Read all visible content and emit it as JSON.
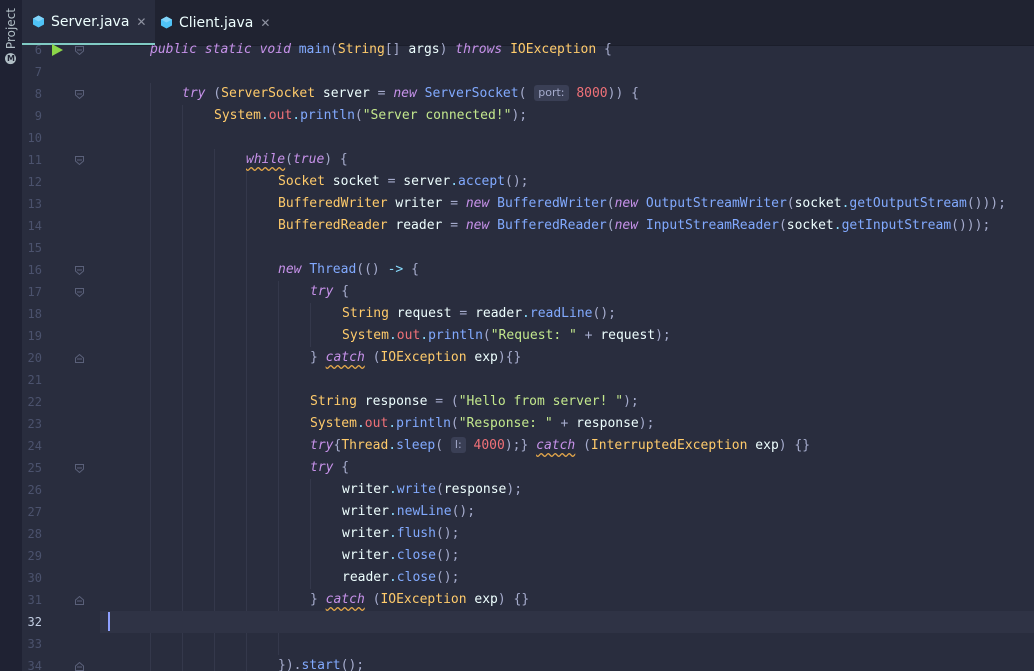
{
  "sidebar": {
    "label": "Project"
  },
  "tabs": [
    {
      "name": "Server.java",
      "active": true
    },
    {
      "name": "Client.java",
      "active": false
    }
  ],
  "colors": {
    "background": "#292d3e",
    "accent": "#80cbc4",
    "run": "#8bd649",
    "caret": "#8ea0ff"
  },
  "editor": {
    "current_line": 32,
    "lines": [
      {
        "n": "6",
        "indent": 1,
        "fold": "open",
        "run": true,
        "tokens": [
          [
            "kw",
            "public"
          ],
          [
            "pl",
            " "
          ],
          [
            "kw",
            "static"
          ],
          [
            "pl",
            " "
          ],
          [
            "kw",
            "void"
          ],
          [
            "pl",
            " "
          ],
          [
            "fn",
            "main"
          ],
          [
            "pl",
            "("
          ],
          [
            "ty",
            "String"
          ],
          [
            "pl",
            "[] "
          ],
          [
            "va",
            "args"
          ],
          [
            "pl",
            ") "
          ],
          [
            "kw",
            "throws"
          ],
          [
            "pl",
            " "
          ],
          [
            "ty",
            "IOException"
          ],
          [
            "pl",
            " {"
          ]
        ]
      },
      {
        "n": "7",
        "indent": 0,
        "tokens": []
      },
      {
        "n": "8",
        "indent": 2,
        "fold": "open",
        "tokens": [
          [
            "kw",
            "try"
          ],
          [
            "pl",
            " ("
          ],
          [
            "ty",
            "ServerSocket"
          ],
          [
            "pl",
            " "
          ],
          [
            "va",
            "server"
          ],
          [
            "pl",
            " = "
          ],
          [
            "kw",
            "new"
          ],
          [
            "pl",
            " "
          ],
          [
            "fn",
            "ServerSocket"
          ],
          [
            "pl",
            "( "
          ],
          [
            "hint",
            "port:"
          ],
          [
            "pl",
            " "
          ],
          [
            "fd",
            "8000"
          ],
          [
            "pl",
            ")) {"
          ]
        ]
      },
      {
        "n": "9",
        "indent": 3,
        "tokens": [
          [
            "ty",
            "System"
          ],
          [
            "pr",
            "."
          ],
          [
            "fd",
            "out"
          ],
          [
            "pr",
            "."
          ],
          [
            "fn",
            "println"
          ],
          [
            "pl",
            "("
          ],
          [
            "st",
            "\"Server connected!\""
          ],
          [
            "pl",
            ");"
          ]
        ]
      },
      {
        "n": "10",
        "indent": 0,
        "tokens": []
      },
      {
        "n": "11",
        "indent": 4,
        "fold": "open",
        "tokens": [
          [
            "kwwavy",
            "while"
          ],
          [
            "pl",
            "("
          ],
          [
            "kw",
            "true"
          ],
          [
            "pl",
            ") {"
          ]
        ]
      },
      {
        "n": "12",
        "indent": 5,
        "tokens": [
          [
            "ty",
            "Socket"
          ],
          [
            "pl",
            " "
          ],
          [
            "va",
            "socket"
          ],
          [
            "pl",
            " = "
          ],
          [
            "va",
            "server"
          ],
          [
            "pr",
            "."
          ],
          [
            "fn",
            "accept"
          ],
          [
            "pl",
            "();"
          ]
        ]
      },
      {
        "n": "13",
        "indent": 5,
        "tokens": [
          [
            "ty",
            "BufferedWriter"
          ],
          [
            "pl",
            " "
          ],
          [
            "va",
            "writer"
          ],
          [
            "pl",
            " = "
          ],
          [
            "kw",
            "new"
          ],
          [
            "pl",
            " "
          ],
          [
            "fn",
            "BufferedWriter"
          ],
          [
            "pl",
            "("
          ],
          [
            "kw",
            "new"
          ],
          [
            "pl",
            " "
          ],
          [
            "fn",
            "OutputStreamWriter"
          ],
          [
            "pl",
            "("
          ],
          [
            "va",
            "socket"
          ],
          [
            "pr",
            "."
          ],
          [
            "fn",
            "getOutputStream"
          ],
          [
            "pl",
            "()));"
          ]
        ]
      },
      {
        "n": "14",
        "indent": 5,
        "tokens": [
          [
            "ty",
            "BufferedReader"
          ],
          [
            "pl",
            " "
          ],
          [
            "va",
            "reader"
          ],
          [
            "pl",
            " = "
          ],
          [
            "kw",
            "new"
          ],
          [
            "pl",
            " "
          ],
          [
            "fn",
            "BufferedReader"
          ],
          [
            "pl",
            "("
          ],
          [
            "kw",
            "new"
          ],
          [
            "pl",
            " "
          ],
          [
            "fn",
            "InputStreamReader"
          ],
          [
            "pl",
            "("
          ],
          [
            "va",
            "socket"
          ],
          [
            "pr",
            "."
          ],
          [
            "fn",
            "getInputStream"
          ],
          [
            "pl",
            "()));"
          ]
        ]
      },
      {
        "n": "15",
        "indent": 0,
        "tokens": []
      },
      {
        "n": "16",
        "indent": 5,
        "fold": "open",
        "tokens": [
          [
            "kw",
            "new"
          ],
          [
            "pl",
            " "
          ],
          [
            "fn",
            "Thread"
          ],
          [
            "pl",
            "(() "
          ],
          [
            "pr",
            "->"
          ],
          [
            "pl",
            " {"
          ]
        ]
      },
      {
        "n": "17",
        "indent": 6,
        "fold": "open",
        "tokens": [
          [
            "kw",
            "try"
          ],
          [
            "pl",
            " {"
          ]
        ]
      },
      {
        "n": "18",
        "indent": 7,
        "tokens": [
          [
            "ty",
            "String"
          ],
          [
            "pl",
            " "
          ],
          [
            "va",
            "request"
          ],
          [
            "pl",
            " = "
          ],
          [
            "va",
            "reader"
          ],
          [
            "pr",
            "."
          ],
          [
            "fn",
            "readLine"
          ],
          [
            "pl",
            "();"
          ]
        ]
      },
      {
        "n": "19",
        "indent": 7,
        "tokens": [
          [
            "ty",
            "System"
          ],
          [
            "pr",
            "."
          ],
          [
            "fd",
            "out"
          ],
          [
            "pr",
            "."
          ],
          [
            "fn",
            "println"
          ],
          [
            "pl",
            "("
          ],
          [
            "st",
            "\"Request: \""
          ],
          [
            "pl",
            " + "
          ],
          [
            "va",
            "request"
          ],
          [
            "pl",
            ");"
          ]
        ]
      },
      {
        "n": "20",
        "indent": 6,
        "fold": "close",
        "tokens": [
          [
            "pl",
            "} "
          ],
          [
            "kwwavy",
            "catch"
          ],
          [
            "pl",
            " ("
          ],
          [
            "ty",
            "IOException"
          ],
          [
            "pl",
            " "
          ],
          [
            "va",
            "exp"
          ],
          [
            "pl",
            "){}"
          ]
        ]
      },
      {
        "n": "21",
        "indent": 0,
        "tokens": []
      },
      {
        "n": "22",
        "indent": 6,
        "tokens": [
          [
            "ty",
            "String"
          ],
          [
            "pl",
            " "
          ],
          [
            "va",
            "response"
          ],
          [
            "pl",
            " = ("
          ],
          [
            "st",
            "\"Hello from server! \""
          ],
          [
            "pl",
            ");"
          ]
        ]
      },
      {
        "n": "23",
        "indent": 6,
        "tokens": [
          [
            "ty",
            "System"
          ],
          [
            "pr",
            "."
          ],
          [
            "fd",
            "out"
          ],
          [
            "pr",
            "."
          ],
          [
            "fn",
            "println"
          ],
          [
            "pl",
            "("
          ],
          [
            "st",
            "\"Response: \""
          ],
          [
            "pl",
            " + "
          ],
          [
            "va",
            "response"
          ],
          [
            "pl",
            ");"
          ]
        ]
      },
      {
        "n": "24",
        "indent": 6,
        "tokens": [
          [
            "kw",
            "try"
          ],
          [
            "pl",
            "{"
          ],
          [
            "ty",
            "Thread"
          ],
          [
            "pr",
            "."
          ],
          [
            "fn",
            "sleep"
          ],
          [
            "pl",
            "( "
          ],
          [
            "hint",
            "l:"
          ],
          [
            "pl",
            " "
          ],
          [
            "fd",
            "4000"
          ],
          [
            "pl",
            ");} "
          ],
          [
            "kwwavy",
            "catch"
          ],
          [
            "pl",
            " ("
          ],
          [
            "ty",
            "InterruptedException"
          ],
          [
            "pl",
            " "
          ],
          [
            "va",
            "exp"
          ],
          [
            "pl",
            ") {}"
          ]
        ]
      },
      {
        "n": "25",
        "indent": 6,
        "fold": "open",
        "tokens": [
          [
            "kw",
            "try"
          ],
          [
            "pl",
            " {"
          ]
        ]
      },
      {
        "n": "26",
        "indent": 7,
        "tokens": [
          [
            "va",
            "writer"
          ],
          [
            "pr",
            "."
          ],
          [
            "fn",
            "write"
          ],
          [
            "pl",
            "("
          ],
          [
            "va",
            "response"
          ],
          [
            "pl",
            ");"
          ]
        ]
      },
      {
        "n": "27",
        "indent": 7,
        "tokens": [
          [
            "va",
            "writer"
          ],
          [
            "pr",
            "."
          ],
          [
            "fn",
            "newLine"
          ],
          [
            "pl",
            "();"
          ]
        ]
      },
      {
        "n": "28",
        "indent": 7,
        "tokens": [
          [
            "va",
            "writer"
          ],
          [
            "pr",
            "."
          ],
          [
            "fn",
            "flush"
          ],
          [
            "pl",
            "();"
          ]
        ]
      },
      {
        "n": "29",
        "indent": 7,
        "tokens": [
          [
            "va",
            "writer"
          ],
          [
            "pr",
            "."
          ],
          [
            "fn",
            "close"
          ],
          [
            "pl",
            "();"
          ]
        ]
      },
      {
        "n": "30",
        "indent": 7,
        "tokens": [
          [
            "va",
            "reader"
          ],
          [
            "pr",
            "."
          ],
          [
            "fn",
            "close"
          ],
          [
            "pl",
            "();"
          ]
        ]
      },
      {
        "n": "31",
        "indent": 6,
        "fold": "close",
        "tokens": [
          [
            "pl",
            "} "
          ],
          [
            "kwwavy",
            "catch"
          ],
          [
            "pl",
            " ("
          ],
          [
            "ty",
            "IOException"
          ],
          [
            "pl",
            " "
          ],
          [
            "va",
            "exp"
          ],
          [
            "pl",
            ") {}"
          ]
        ]
      },
      {
        "n": "32",
        "indent": 0,
        "tokens": []
      },
      {
        "n": "33",
        "indent": 0,
        "tokens": []
      },
      {
        "n": "34",
        "indent": 5,
        "fold": "close",
        "tokens": [
          [
            "pl",
            "})."
          ],
          [
            "fn",
            "start"
          ],
          [
            "pl",
            "();"
          ]
        ]
      }
    ]
  }
}
